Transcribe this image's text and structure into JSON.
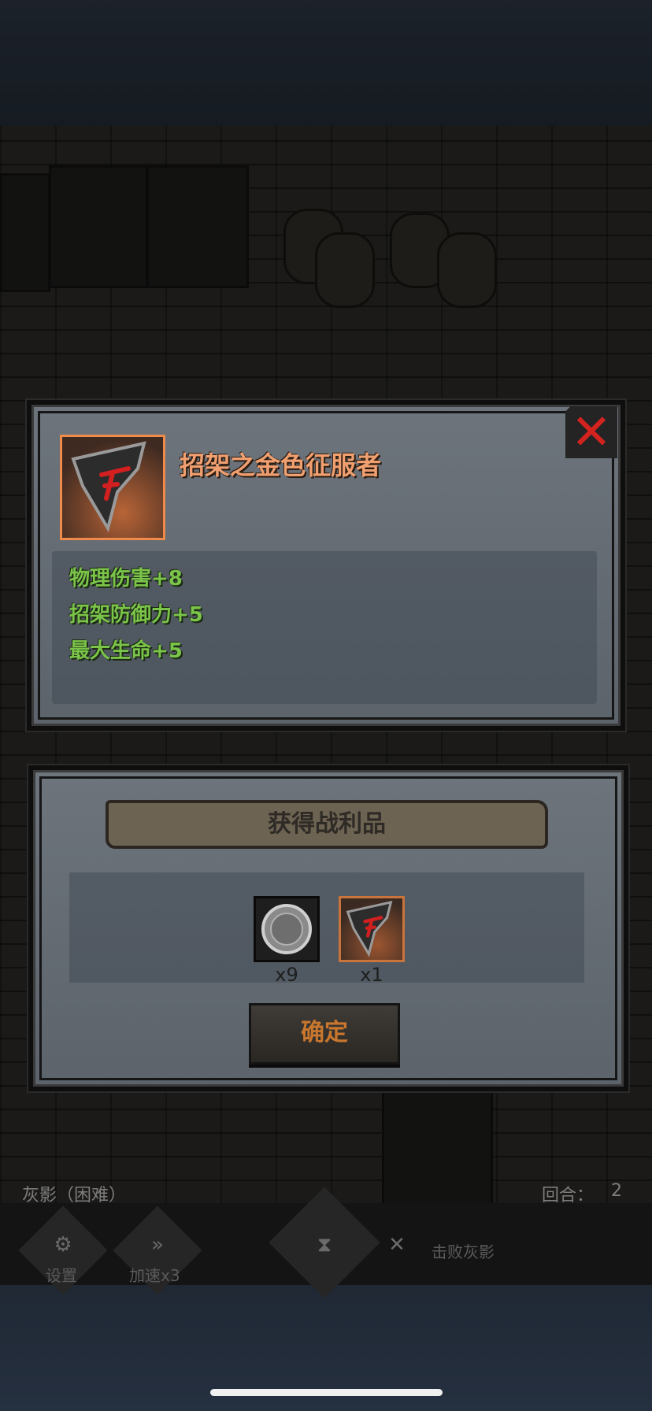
{
  "hud": {
    "boss_label": "灰影（困难）",
    "round_label": "回合：",
    "round_value": "2",
    "settings_label": "设置",
    "speed_label": "加速x3",
    "speed_icon": "fast-forward-icon",
    "settings_icon": "gear-icon",
    "objective_label": "击败灰影",
    "objective_icon": "crossed-swords-icon",
    "center_icon": "hourglass-icon"
  },
  "item_panel": {
    "name": "招架之金色征服者",
    "close_icon": "close-icon",
    "close_glyph": "✕",
    "stats": [
      "物理伤害+8",
      "招架防御力+5",
      "最大生命+5"
    ]
  },
  "loot_panel": {
    "title": "获得战利品",
    "rewards": [
      {
        "icon": "silver-coin-icon",
        "count": "x9"
      },
      {
        "icon": "parry-shield-icon",
        "count": "x1"
      }
    ],
    "confirm_label": "确定"
  },
  "colors": {
    "item_name": "#f0a070",
    "stat_green": "#7bc44a",
    "close_red": "#d2231f",
    "confirm_text": "#c9772f"
  }
}
